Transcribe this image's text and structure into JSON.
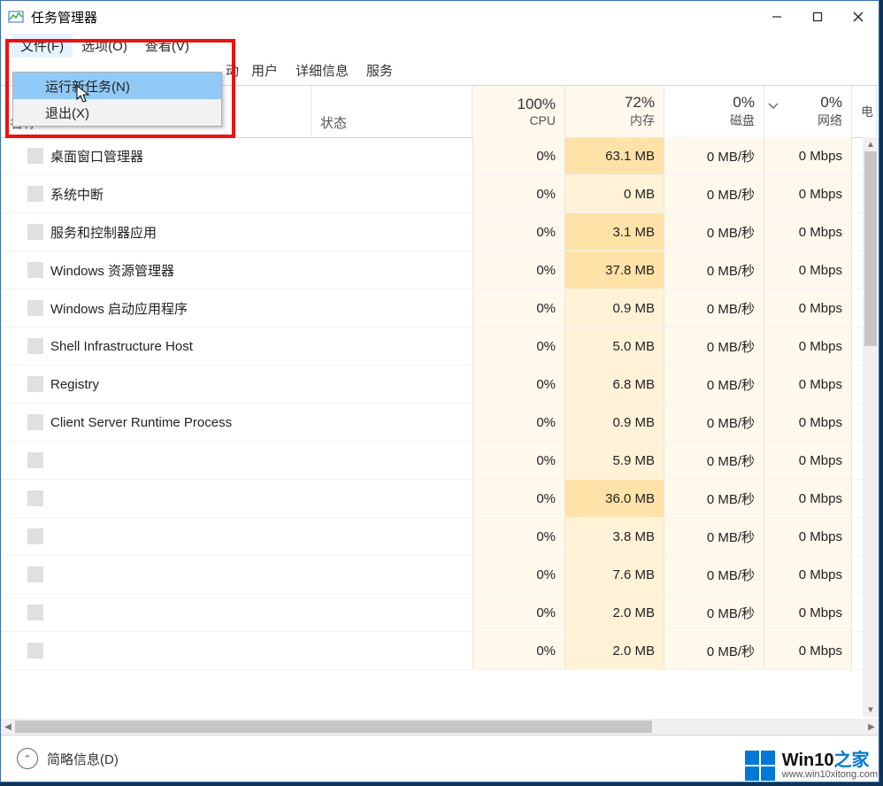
{
  "window": {
    "title": "任务管理器"
  },
  "menu": {
    "file": "文件(F)",
    "options": "选项(O)",
    "view": "查看(V)",
    "dropdown": {
      "runNew": "运行新任务(N)",
      "exit": "退出(X)"
    }
  },
  "tabs": {
    "frag": "动",
    "users": "用户",
    "details": "详细信息",
    "services": "服务"
  },
  "columns": {
    "name": "名称",
    "status": "状态",
    "cpu": {
      "pct": "100%",
      "label": "CPU"
    },
    "mem": {
      "pct": "72%",
      "label": "内存"
    },
    "disk": {
      "pct": "0%",
      "label": "磁盘"
    },
    "net": {
      "pct": "0%",
      "label": "网络"
    },
    "last": "电"
  },
  "rows": [
    {
      "name": "桌面窗口管理器",
      "cpu": "0%",
      "mem": "63.1 MB",
      "memHot": true,
      "disk": "0 MB/秒",
      "net": "0 Mbps"
    },
    {
      "name": "系统中断",
      "cpu": "0%",
      "mem": "0 MB",
      "memHot": false,
      "disk": "0 MB/秒",
      "net": "0 Mbps"
    },
    {
      "name": "服务和控制器应用",
      "cpu": "0%",
      "mem": "3.1 MB",
      "memHot": true,
      "disk": "0 MB/秒",
      "net": "0 Mbps"
    },
    {
      "name": "Windows 资源管理器",
      "cpu": "0%",
      "mem": "37.8 MB",
      "memHot": true,
      "disk": "0 MB/秒",
      "net": "0 Mbps"
    },
    {
      "name": "Windows 启动应用程序",
      "cpu": "0%",
      "mem": "0.9 MB",
      "memHot": false,
      "disk": "0 MB/秒",
      "net": "0 Mbps"
    },
    {
      "name": "Shell Infrastructure Host",
      "cpu": "0%",
      "mem": "5.0 MB",
      "memHot": false,
      "disk": "0 MB/秒",
      "net": "0 Mbps"
    },
    {
      "name": "Registry",
      "cpu": "0%",
      "mem": "6.8 MB",
      "memHot": false,
      "disk": "0 MB/秒",
      "net": "0 Mbps"
    },
    {
      "name": "Client Server Runtime Process",
      "cpu": "0%",
      "mem": "0.9 MB",
      "memHot": false,
      "disk": "0 MB/秒",
      "net": "0 Mbps"
    },
    {
      "name": "",
      "cpu": "0%",
      "mem": "5.9 MB",
      "memHot": false,
      "disk": "0 MB/秒",
      "net": "0 Mbps"
    },
    {
      "name": "",
      "cpu": "0%",
      "mem": "36.0 MB",
      "memHot": true,
      "disk": "0 MB/秒",
      "net": "0 Mbps"
    },
    {
      "name": "",
      "cpu": "0%",
      "mem": "3.8 MB",
      "memHot": false,
      "disk": "0 MB/秒",
      "net": "0 Mbps"
    },
    {
      "name": "",
      "cpu": "0%",
      "mem": "7.6 MB",
      "memHot": false,
      "disk": "0 MB/秒",
      "net": "0 Mbps"
    },
    {
      "name": "",
      "cpu": "0%",
      "mem": "2.0 MB",
      "memHot": false,
      "disk": "0 MB/秒",
      "net": "0 Mbps"
    },
    {
      "name": "",
      "cpu": "0%",
      "mem": "2.0 MB",
      "memHot": false,
      "disk": "0 MB/秒",
      "net": "0 Mbps"
    }
  ],
  "footer": {
    "fewer": "简略信息(D)"
  },
  "watermark": {
    "line1a": "Win10",
    "line1b": "之家",
    "line2": "www.win10xitong.com"
  }
}
